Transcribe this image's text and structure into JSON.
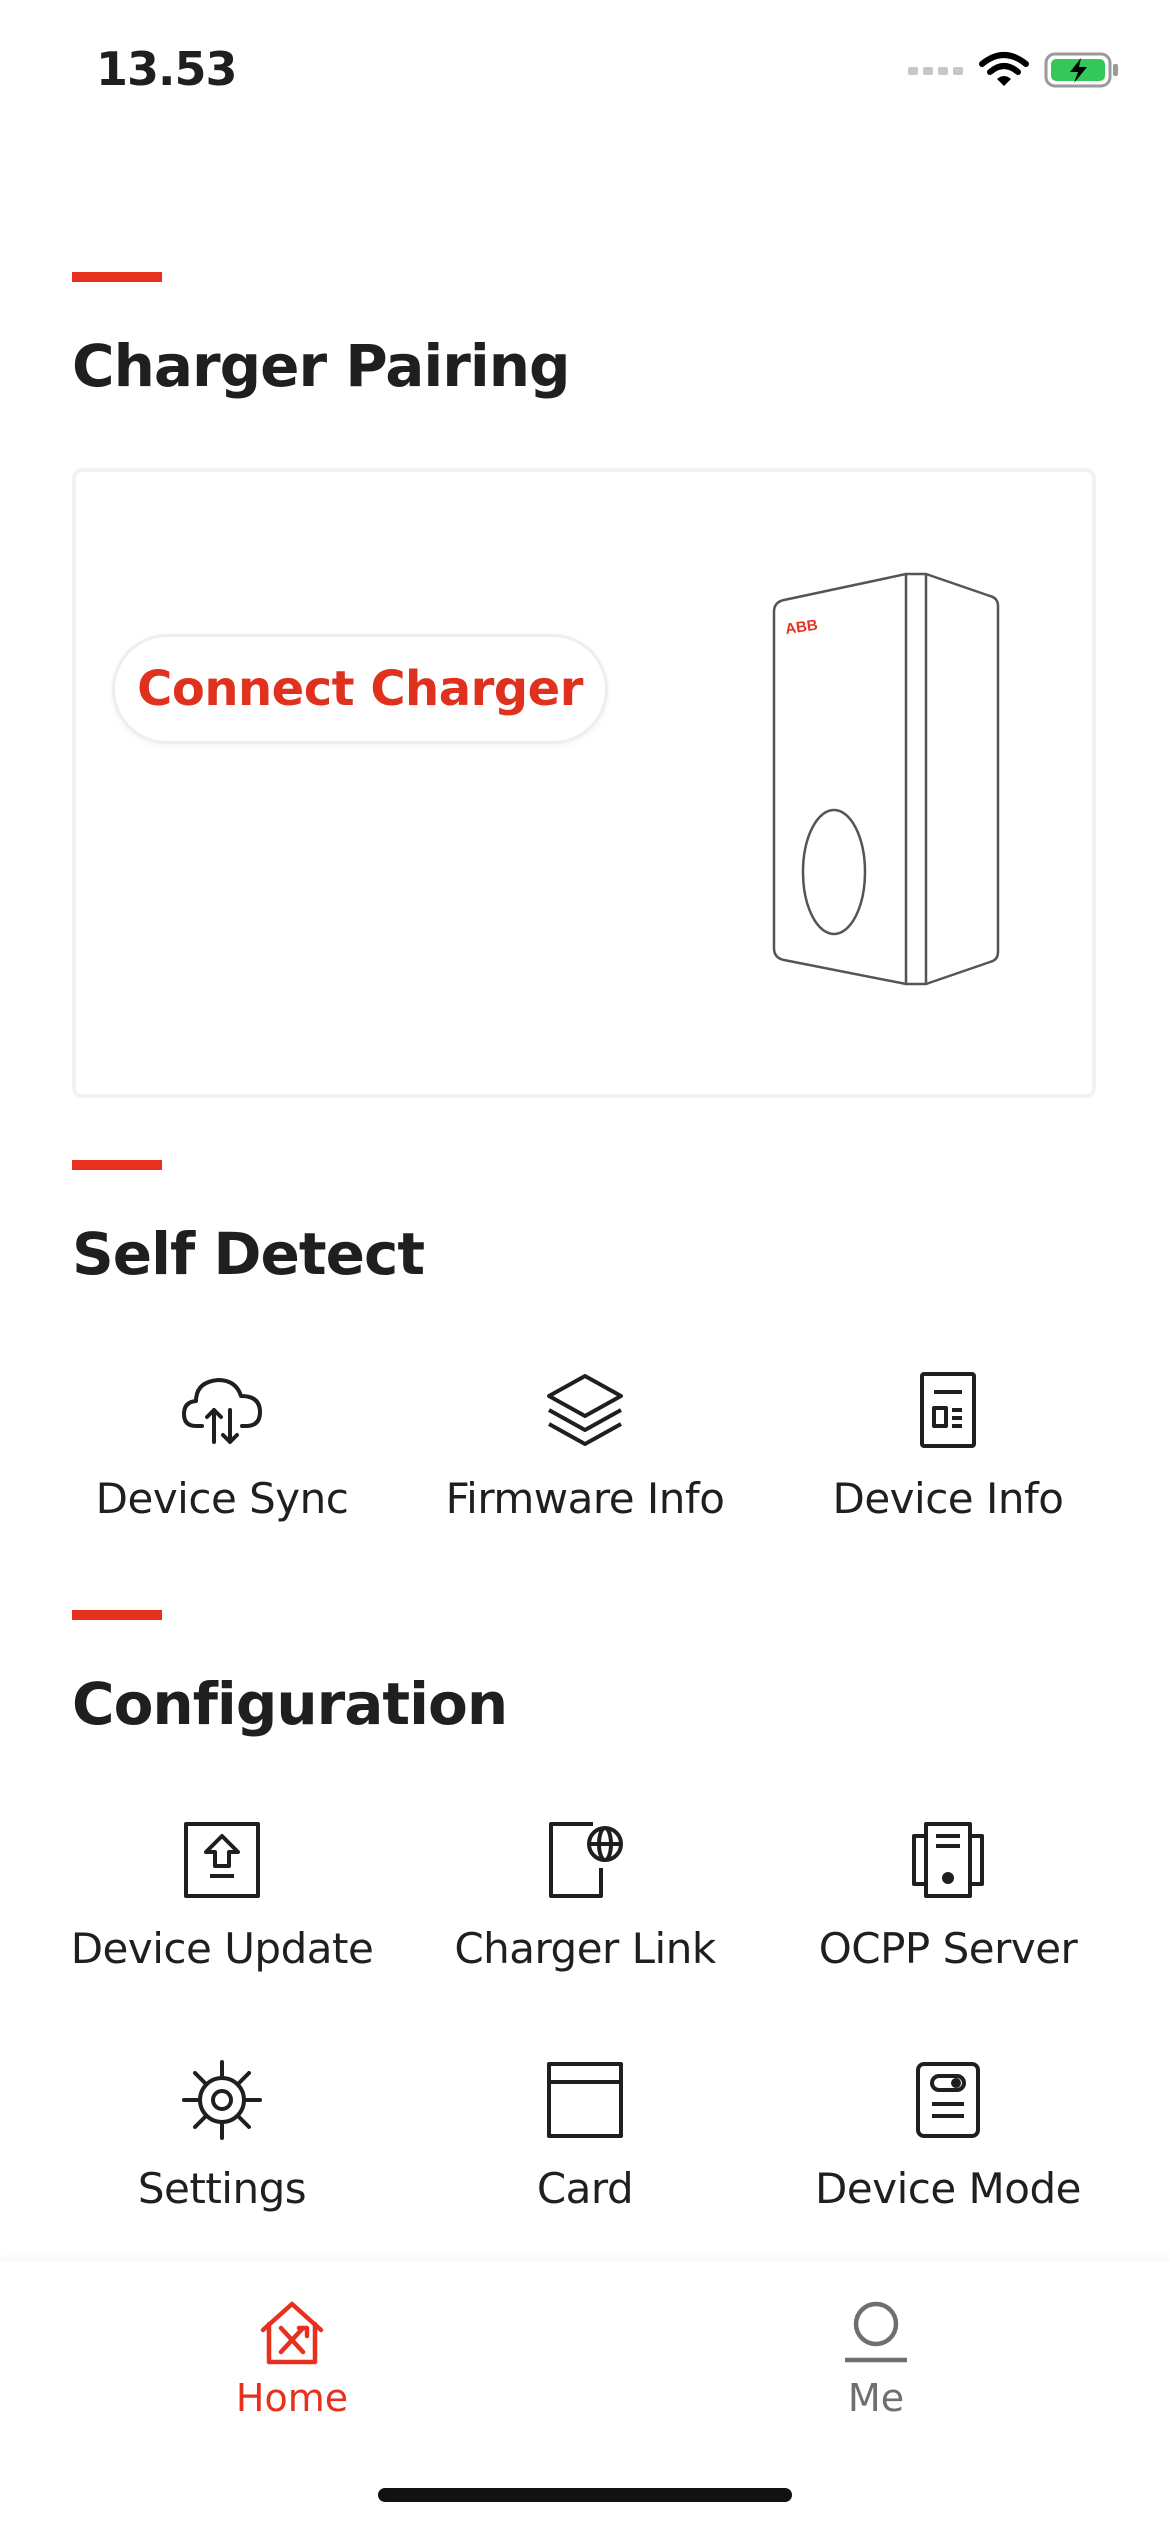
{
  "status_bar": {
    "time": "13.53"
  },
  "pairing": {
    "title": "Charger Pairing",
    "connect_button": "Connect Charger",
    "brand_mark": "ABB"
  },
  "self_detect": {
    "title": "Self Detect",
    "items": [
      {
        "label": "Device Sync",
        "icon": "cloud-sync-icon"
      },
      {
        "label": "Firmware Info",
        "icon": "layers-icon"
      },
      {
        "label": "Device Info",
        "icon": "document-icon"
      }
    ]
  },
  "configuration": {
    "title": "Configuration",
    "items": [
      {
        "label": "Device Update",
        "icon": "upload-box-icon"
      },
      {
        "label": "Charger Link",
        "icon": "globe-door-icon"
      },
      {
        "label": "OCPP Server",
        "icon": "server-icon"
      },
      {
        "label": "Settings",
        "icon": "gear-icon"
      },
      {
        "label": "Card",
        "icon": "card-icon"
      },
      {
        "label": "Device Mode",
        "icon": "device-mode-icon"
      }
    ]
  },
  "tab_bar": {
    "tabs": [
      {
        "label": "Home",
        "icon": "home-icon",
        "active": true
      },
      {
        "label": "Me",
        "icon": "person-icon",
        "active": false
      }
    ]
  },
  "colors": {
    "accent": "#e8301f",
    "text": "#1f1f1f",
    "inactive": "#6f6f6f"
  }
}
